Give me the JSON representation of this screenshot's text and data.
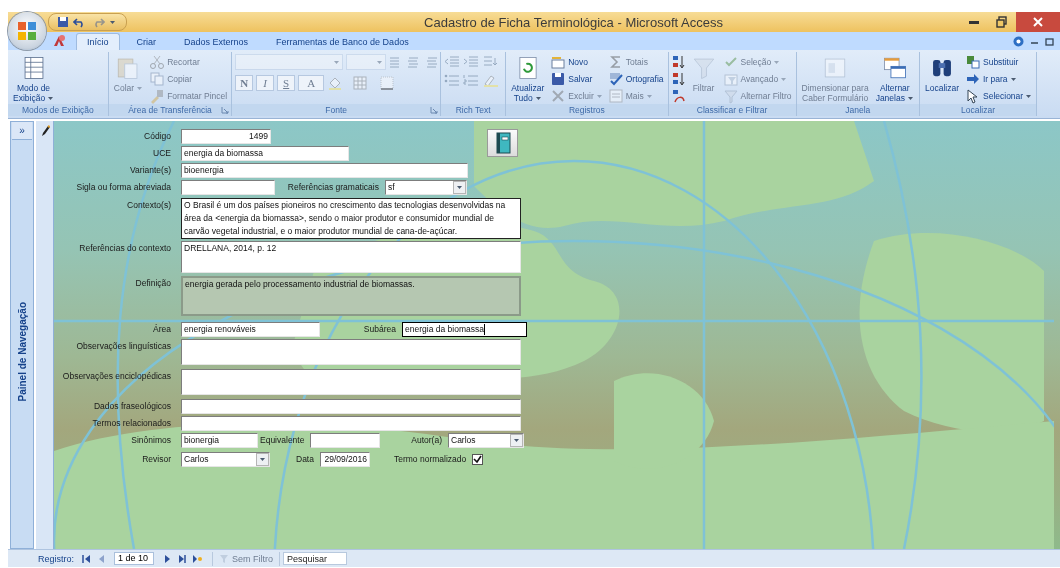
{
  "window": {
    "title": "Cadastro de Ficha Terminológica - Microsoft Access"
  },
  "ribbon_tabs": [
    {
      "label": "Início",
      "selected": true
    },
    {
      "label": "Criar",
      "selected": false
    },
    {
      "label": "Dados Externos",
      "selected": false
    },
    {
      "label": "Ferramentas de Banco de Dados",
      "selected": false
    }
  ],
  "ribbon_groups": [
    {
      "label": "Modos de Exibição",
      "launcher": false,
      "items": [
        {
          "kind": "large",
          "label": "Modo de\nExibição",
          "dropdown": true,
          "disabled": false
        }
      ]
    },
    {
      "label": "Área de Transferência",
      "launcher": true,
      "items": [
        {
          "kind": "large",
          "label": "Colar",
          "dropdown": true,
          "disabled": true
        },
        {
          "kind": "small",
          "label": "Recortar",
          "dropdown": false,
          "disabled": true
        },
        {
          "kind": "small",
          "label": "Copiar",
          "dropdown": false,
          "disabled": true
        },
        {
          "kind": "small",
          "label": "Formatar Pincel",
          "dropdown": false,
          "disabled": true
        }
      ]
    },
    {
      "label": "Fonte",
      "launcher": true,
      "items": [
        {
          "kind": "font",
          "letters": [
            "N",
            "I",
            "S",
            "A"
          ],
          "disabled": true
        }
      ]
    },
    {
      "label": "Rich Text",
      "launcher": false,
      "items": [
        {
          "kind": "rich",
          "disabled": true
        }
      ]
    },
    {
      "label": "Registros",
      "launcher": false,
      "items": [
        {
          "kind": "large",
          "label": "Atualizar\nTudo",
          "dropdown": true,
          "disabled": false
        },
        {
          "kind": "small",
          "label": "Novo",
          "dropdown": false,
          "disabled": false
        },
        {
          "kind": "small",
          "label": "Salvar",
          "dropdown": false,
          "disabled": false
        },
        {
          "kind": "small",
          "label": "Excluir",
          "dropdown": true,
          "disabled": true
        },
        {
          "kind": "small",
          "label": "Totais",
          "dropdown": false,
          "disabled": true
        },
        {
          "kind": "small",
          "label": "Ortografia",
          "dropdown": false,
          "disabled": false
        },
        {
          "kind": "small",
          "label": "Mais",
          "dropdown": true,
          "disabled": true
        }
      ]
    },
    {
      "label": "Classificar e Filtrar",
      "launcher": false,
      "items": [
        {
          "kind": "sort",
          "disabled": false
        },
        {
          "kind": "large",
          "label": "Filtrar",
          "dropdown": false,
          "disabled": true
        },
        {
          "kind": "small",
          "label": "Seleção",
          "dropdown": true,
          "disabled": true
        },
        {
          "kind": "small",
          "label": "Avançado",
          "dropdown": true,
          "disabled": true
        },
        {
          "kind": "small",
          "label": "Alternar Filtro",
          "dropdown": false,
          "disabled": true
        }
      ]
    },
    {
      "label": "Janela",
      "launcher": false,
      "items": [
        {
          "kind": "large",
          "label": "Dimensionar para\nCaber Formulário",
          "dropdown": false,
          "disabled": true
        },
        {
          "kind": "large",
          "label": "Alternar\nJanelas",
          "dropdown": true,
          "disabled": false
        }
      ]
    },
    {
      "label": "Localizar",
      "launcher": false,
      "items": [
        {
          "kind": "large",
          "label": "Localizar",
          "dropdown": false,
          "disabled": false
        },
        {
          "kind": "small",
          "label": "Substituir",
          "dropdown": false,
          "disabled": false
        },
        {
          "kind": "small",
          "label": "Ir para",
          "dropdown": true,
          "disabled": false
        },
        {
          "kind": "small",
          "label": "Selecionar",
          "dropdown": true,
          "disabled": false
        }
      ]
    }
  ],
  "nav_pane": {
    "toggle": "»",
    "title": "Painel de Navegação"
  },
  "record_selector": {
    "editing": true
  },
  "form": {
    "rows": [
      {
        "fields": [
          {
            "kind": "number",
            "label": "Código",
            "value": "1499",
            "locked": false,
            "focused": false
          }
        ]
      },
      {
        "fields": [
          {
            "kind": "text",
            "label": "UCE",
            "value": "energia da biomassa",
            "locked": false,
            "focused": false
          }
        ]
      },
      {
        "fields": [
          {
            "kind": "text",
            "label": "Variante(s)",
            "value": "bioenergia",
            "locked": false,
            "focused": false
          }
        ]
      },
      {
        "fields": [
          {
            "kind": "text",
            "label": "Sigla ou forma abreviada",
            "locked": false,
            "focused": false
          },
          {
            "kind": "combo",
            "label": "Referências gramaticais",
            "value": "sf",
            "locked": false,
            "focused": false
          }
        ]
      },
      {
        "fields": [
          {
            "kind": "memo",
            "label": "Contexto(s)",
            "value": "O Brasil é um dos países pioneiros no crescimento das tecnologias desenvolvidas na área da <energia da biomassa>, sendo o maior produtor e consumidor mundial de carvão vegetal industrial, e o maior produtor mundial de cana-de-açúcar.",
            "locked": false,
            "focused": false
          }
        ]
      },
      {
        "fields": [
          {
            "kind": "memo",
            "label": "Referências do contexto",
            "value": "DRELLANA, 2014, p. 12",
            "locked": false,
            "focused": false
          }
        ]
      },
      {
        "fields": [
          {
            "kind": "memo",
            "label": "Definição",
            "value": "energia gerada pelo processamento industrial de biomassas.",
            "locked": true,
            "focused": false
          }
        ]
      },
      {
        "fields": [
          {
            "kind": "text",
            "label": "Área",
            "value": "energia renováveis",
            "locked": false,
            "focused": false
          },
          {
            "kind": "text",
            "label": "Subárea",
            "value": "energia da biomassa",
            "locked": false,
            "focused": true
          }
        ]
      },
      {
        "fields": [
          {
            "kind": "memo",
            "label": "Observações linguísticas",
            "locked": false,
            "focused": false
          }
        ]
      },
      {
        "fields": [
          {
            "kind": "memo",
            "label": "Observações enciclopédicas",
            "locked": false,
            "focused": false
          }
        ]
      },
      {
        "fields": [
          {
            "kind": "text",
            "label": "Dados fraseológicos",
            "locked": false,
            "focused": false
          }
        ]
      },
      {
        "fields": [
          {
            "kind": "text",
            "label": "Termos relacionados",
            "locked": false,
            "focused": false
          }
        ]
      },
      {
        "fields": [
          {
            "kind": "text",
            "label": "Sinônimos",
            "value": "bionergia",
            "locked": false,
            "focused": false
          },
          {
            "kind": "text",
            "label": "Equivalente",
            "locked": false,
            "focused": false
          },
          {
            "kind": "combo",
            "label": "Autor(a)",
            "value": "Carlos",
            "locked": false,
            "focused": false
          }
        ]
      },
      {
        "fields": [
          {
            "kind": "combo",
            "label": "Revisor",
            "value": "Carlos",
            "locked": false,
            "focused": false
          },
          {
            "kind": "date",
            "label": "Data",
            "value": "29/09/2016",
            "locked": false,
            "focused": false
          },
          {
            "kind": "check",
            "label": "Termo normalizado",
            "checked": true
          }
        ]
      }
    ]
  },
  "record_nav": {
    "label": "Registro:",
    "buttons": [
      {
        "kind": "first",
        "disabled": false
      },
      {
        "kind": "previous",
        "disabled": true
      },
      {
        "kind": "next",
        "disabled": false
      },
      {
        "kind": "last",
        "disabled": false
      },
      {
        "kind": "new",
        "disabled": false
      }
    ],
    "position": "1 de 10",
    "filter": {
      "label": "Sem Filtro",
      "disabled": true
    },
    "search": {
      "placeholder": "Pesquisar"
    }
  }
}
